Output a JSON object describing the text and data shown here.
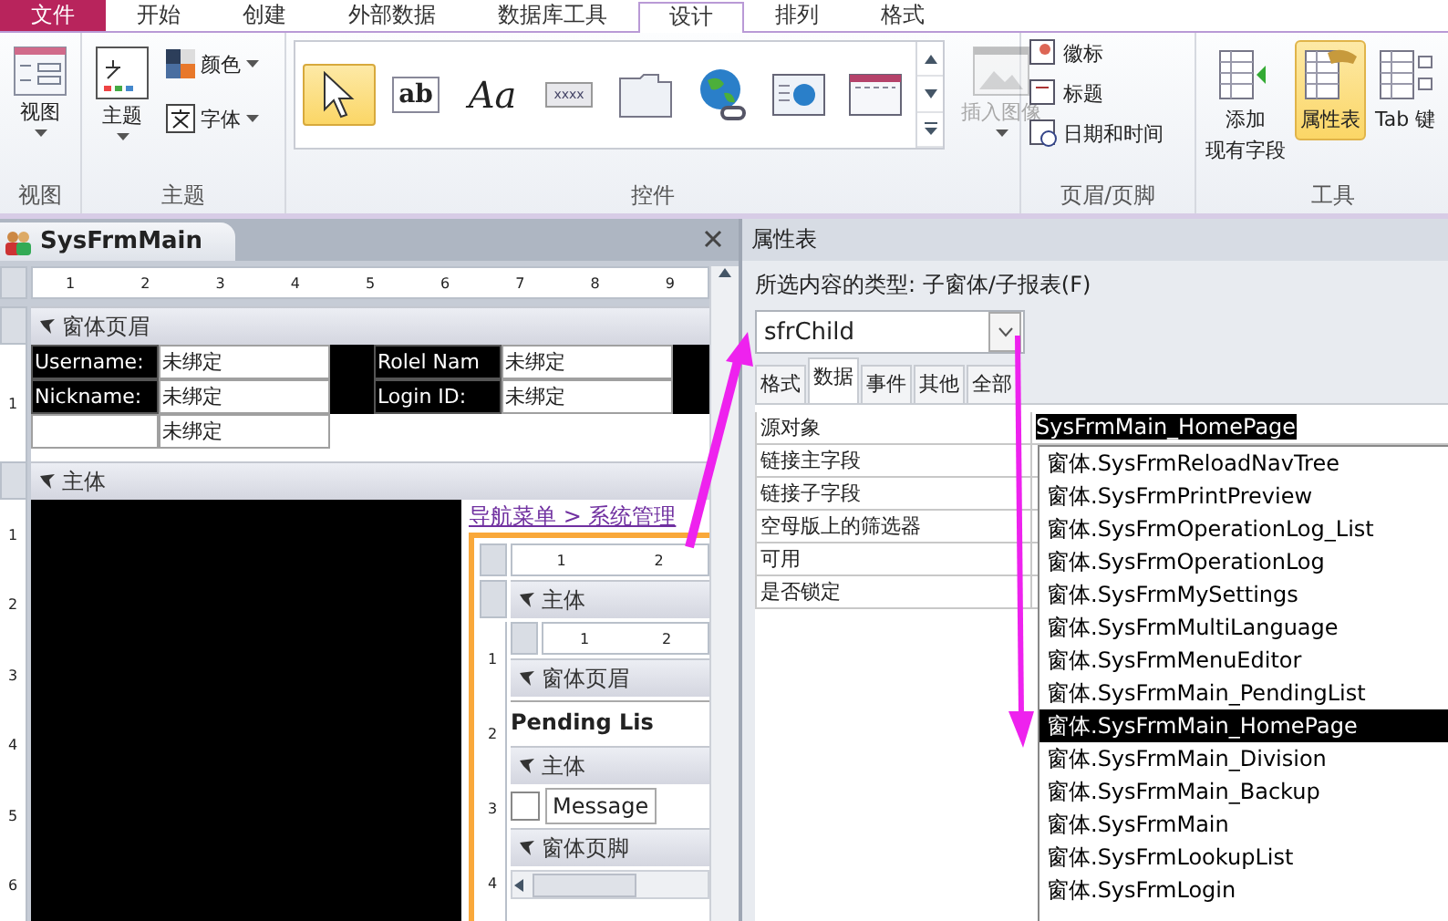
{
  "ribbon_tabs": [
    {
      "label": "文件",
      "kind": "file",
      "selected": false
    },
    {
      "label": "开始",
      "kind": "tab",
      "selected": false
    },
    {
      "label": "创建",
      "kind": "tab",
      "selected": false
    },
    {
      "label": "外部数据",
      "kind": "tab",
      "selected": false
    },
    {
      "label": "数据库工具",
      "kind": "tab",
      "selected": false
    },
    {
      "label": "设计",
      "kind": "tab",
      "selected": true
    },
    {
      "label": "排列",
      "kind": "tab",
      "selected": false
    },
    {
      "label": "格式",
      "kind": "tab",
      "selected": false
    }
  ],
  "ribbon_groups": [
    {
      "kind": "view",
      "title": "视图",
      "items": [
        {
          "label": "视图"
        }
      ]
    },
    {
      "kind": "themes",
      "title": "主题",
      "items": [
        {
          "label": "主题"
        },
        {
          "label": "颜色"
        },
        {
          "label": "字体"
        }
      ]
    },
    {
      "kind": "controls",
      "title": "控件",
      "gallery": [
        {
          "kind": "pointer",
          "selected": true
        },
        {
          "kind": "textbox",
          "text": "ab",
          "selected": false
        },
        {
          "kind": "label",
          "text": "Aa",
          "selected": false
        },
        {
          "kind": "button",
          "text": "xxxx",
          "selected": false
        },
        {
          "kind": "tab",
          "selected": false
        },
        {
          "kind": "hyperlink",
          "selected": false
        },
        {
          "kind": "web",
          "selected": false
        },
        {
          "kind": "navigation",
          "selected": false
        }
      ],
      "items": [
        {
          "label": "插入图像",
          "disabled": true
        }
      ]
    },
    {
      "kind": "header_footer",
      "title": "页眉/页脚",
      "items": [
        {
          "label": "徽标"
        },
        {
          "label": "标题"
        },
        {
          "label": "日期和时间"
        }
      ]
    },
    {
      "kind": "tools",
      "title": "工具",
      "items": [
        {
          "lines": [
            "添加",
            "现有字段"
          ],
          "selected": false
        },
        {
          "label": "属性表",
          "selected": true
        },
        {
          "label": "Tab 键",
          "selected": false
        }
      ]
    }
  ],
  "document": {
    "tab": "SysFrmMain",
    "ruler": [
      "1",
      "2",
      "3",
      "4",
      "5",
      "6",
      "7",
      "8",
      "9"
    ],
    "form_header": {
      "title": "窗体页眉",
      "vruler": [
        "1"
      ],
      "rows": [
        [
          {
            "kind": "label",
            "text": "Username:"
          },
          {
            "kind": "field",
            "text": "未绑定"
          },
          {
            "kind": "gap"
          },
          {
            "kind": "label",
            "text": "Rolel Nam"
          },
          {
            "kind": "field",
            "text": "未绑定"
          }
        ],
        [
          {
            "kind": "label",
            "text": "Nickname:"
          },
          {
            "kind": "field",
            "text": "未绑定"
          },
          {
            "kind": "gap"
          },
          {
            "kind": "label",
            "text": "Login ID:"
          },
          {
            "kind": "field",
            "text": "未绑定"
          }
        ],
        [
          {
            "kind": "blank"
          },
          {
            "kind": "field",
            "text": "未绑定"
          }
        ]
      ]
    },
    "detail": {
      "title": "主体",
      "vruler": [
        "1",
        "2",
        "3",
        "4",
        "5",
        "6"
      ],
      "subform": {
        "breadcrumb": "导航菜单 > 系统管理",
        "ruler": [
          "1",
          "2"
        ],
        "section": "主体",
        "inner_ruler": [
          "1",
          "2"
        ],
        "vruler": [
          "1",
          "2",
          "3",
          "4"
        ],
        "rows": [
          {
            "kind": "section",
            "text": "窗体页眉"
          },
          {
            "kind": "title",
            "text": "Pending Lis"
          },
          {
            "kind": "section",
            "text": "主体"
          },
          {
            "kind": "checkbox",
            "text": "Message",
            "checked": false
          },
          {
            "kind": "section",
            "text": "窗体页脚"
          }
        ]
      }
    }
  },
  "property_sheet": {
    "title": "属性表",
    "selection_type": "所选内容的类型: 子窗体/子报表(F)",
    "object": "sfrChild",
    "tabs": [
      {
        "label": "格式",
        "selected": false
      },
      {
        "label": "数据",
        "selected": true
      },
      {
        "label": "事件",
        "selected": false
      },
      {
        "label": "其他",
        "selected": false
      },
      {
        "label": "全部",
        "selected": false
      }
    ],
    "rows": [
      {
        "label": "源对象",
        "value": "SysFrmMain_HomePage"
      },
      {
        "label": "链接主字段"
      },
      {
        "label": "链接子字段"
      },
      {
        "label": "空母版上的筛选器"
      },
      {
        "label": "可用"
      },
      {
        "label": "是否锁定"
      }
    ],
    "dropdown": [
      {
        "text": "窗体.SysFrmReloadNavTree",
        "selected": false
      },
      {
        "text": "窗体.SysFrmPrintPreview",
        "selected": false
      },
      {
        "text": "窗体.SysFrmOperationLog_List",
        "selected": false
      },
      {
        "text": "窗体.SysFrmOperationLog",
        "selected": false
      },
      {
        "text": "窗体.SysFrmMySettings",
        "selected": false
      },
      {
        "text": "窗体.SysFrmMultiLanguage",
        "selected": false
      },
      {
        "text": "窗体.SysFrmMenuEditor",
        "selected": false
      },
      {
        "text": "窗体.SysFrmMain_PendingList",
        "selected": false
      },
      {
        "text": "窗体.SysFrmMain_HomePage",
        "selected": true
      },
      {
        "text": "窗体.SysFrmMain_Division",
        "selected": false
      },
      {
        "text": "窗体.SysFrmMain_Backup",
        "selected": false
      },
      {
        "text": "窗体.SysFrmMain",
        "selected": false
      },
      {
        "text": "窗体.SysFrmLookupList",
        "selected": false
      },
      {
        "text": "窗体.SysFrmLogin",
        "selected": false
      }
    ]
  }
}
